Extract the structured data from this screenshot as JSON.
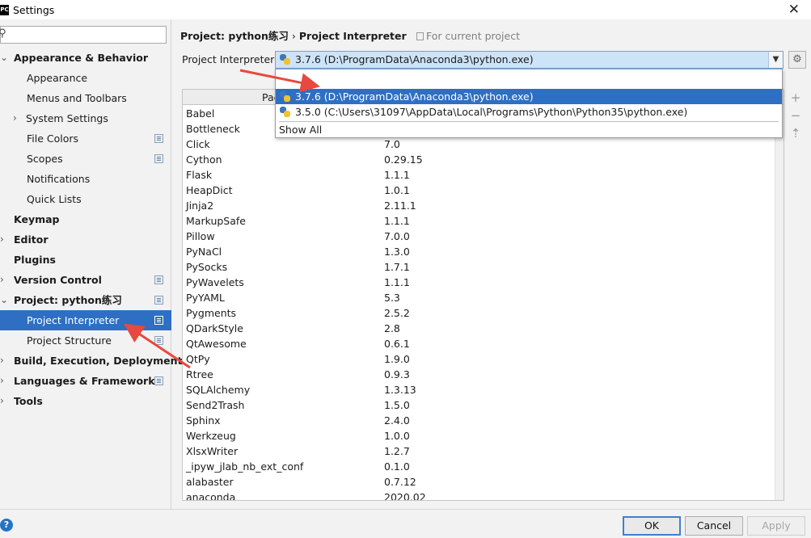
{
  "window": {
    "title": "Settings",
    "logo": "PC"
  },
  "search": {
    "placeholder": "",
    "value": ""
  },
  "sidebar": {
    "items": [
      {
        "label": "Appearance & Behavior",
        "bold": true,
        "chevron": "expanded"
      },
      {
        "label": "Appearance"
      },
      {
        "label": "Menus and Toolbars"
      },
      {
        "label": "System Settings",
        "chevron": "collapsed"
      },
      {
        "label": "File Colors",
        "project_icon": true
      },
      {
        "label": "Scopes",
        "project_icon": true
      },
      {
        "label": "Notifications"
      },
      {
        "label": "Quick Lists"
      },
      {
        "label": "Keymap",
        "bold": true
      },
      {
        "label": "Editor",
        "bold": true,
        "chevron": "collapsed"
      },
      {
        "label": "Plugins",
        "bold": true
      },
      {
        "label": "Version Control",
        "bold": true,
        "chevron": "collapsed",
        "project_icon": true
      },
      {
        "label": "Project: python练习",
        "bold": true,
        "chevron": "expanded",
        "project_icon": true
      },
      {
        "label": "Project Interpreter",
        "selected": true,
        "project_icon": true
      },
      {
        "label": "Project Structure",
        "project_icon": true
      },
      {
        "label": "Build, Execution, Deployment",
        "bold": true,
        "chevron": "collapsed"
      },
      {
        "label": "Languages & Frameworks",
        "bold": true,
        "chevron": "collapsed",
        "project_icon": true
      },
      {
        "label": "Tools",
        "bold": true,
        "chevron": "collapsed"
      }
    ]
  },
  "breadcrumb": {
    "project": "Project: python练习",
    "separator": "›",
    "page": "Project Interpreter",
    "scope": "For current project"
  },
  "interpreter": {
    "label": "Project Interpreter:",
    "selected": "3.7.6 (D:\\ProgramData\\Anaconda3\\python.exe)",
    "options": [
      "3.7.6 (D:\\ProgramData\\Anaconda3\\python.exe)",
      "3.5.0 (C:\\Users\\31097\\AppData\\Local\\Programs\\Python\\Python35\\python.exe)"
    ],
    "show_all": "Show All"
  },
  "packages": {
    "header_package": "Pac",
    "rows": [
      {
        "name": "Babel",
        "version": ""
      },
      {
        "name": "Bottleneck",
        "version": ""
      },
      {
        "name": "Click",
        "version": "7.0"
      },
      {
        "name": "Cython",
        "version": "0.29.15"
      },
      {
        "name": "Flask",
        "version": "1.1.1"
      },
      {
        "name": "HeapDict",
        "version": "1.0.1"
      },
      {
        "name": "Jinja2",
        "version": "2.11.1"
      },
      {
        "name": "MarkupSafe",
        "version": "1.1.1"
      },
      {
        "name": "Pillow",
        "version": "7.0.0"
      },
      {
        "name": "PyNaCl",
        "version": "1.3.0"
      },
      {
        "name": "PySocks",
        "version": "1.7.1"
      },
      {
        "name": "PyWavelets",
        "version": "1.1.1"
      },
      {
        "name": "PyYAML",
        "version": "5.3"
      },
      {
        "name": "Pygments",
        "version": "2.5.2"
      },
      {
        "name": "QDarkStyle",
        "version": "2.8"
      },
      {
        "name": "QtAwesome",
        "version": "0.6.1"
      },
      {
        "name": "QtPy",
        "version": "1.9.0"
      },
      {
        "name": "Rtree",
        "version": "0.9.3"
      },
      {
        "name": "SQLAlchemy",
        "version": "1.3.13"
      },
      {
        "name": "Send2Trash",
        "version": "1.5.0"
      },
      {
        "name": "Sphinx",
        "version": "2.4.0"
      },
      {
        "name": "Werkzeug",
        "version": "1.0.0"
      },
      {
        "name": "XlsxWriter",
        "version": "1.2.7"
      },
      {
        "name": "_ipyw_jlab_nb_ext_conf",
        "version": "0.1.0"
      },
      {
        "name": "alabaster",
        "version": "0.7.12"
      },
      {
        "name": "anaconda",
        "version": "2020.02"
      }
    ]
  },
  "side_tools": {
    "add": "+",
    "remove": "−",
    "upgrade": "⇡"
  },
  "footer": {
    "help": "?",
    "ok": "OK",
    "cancel": "Cancel",
    "apply": "Apply"
  },
  "colors": {
    "selection": "#2e6fc3",
    "annotation_arrow": "#e8483f",
    "combo_bg": "#cde3f7"
  }
}
